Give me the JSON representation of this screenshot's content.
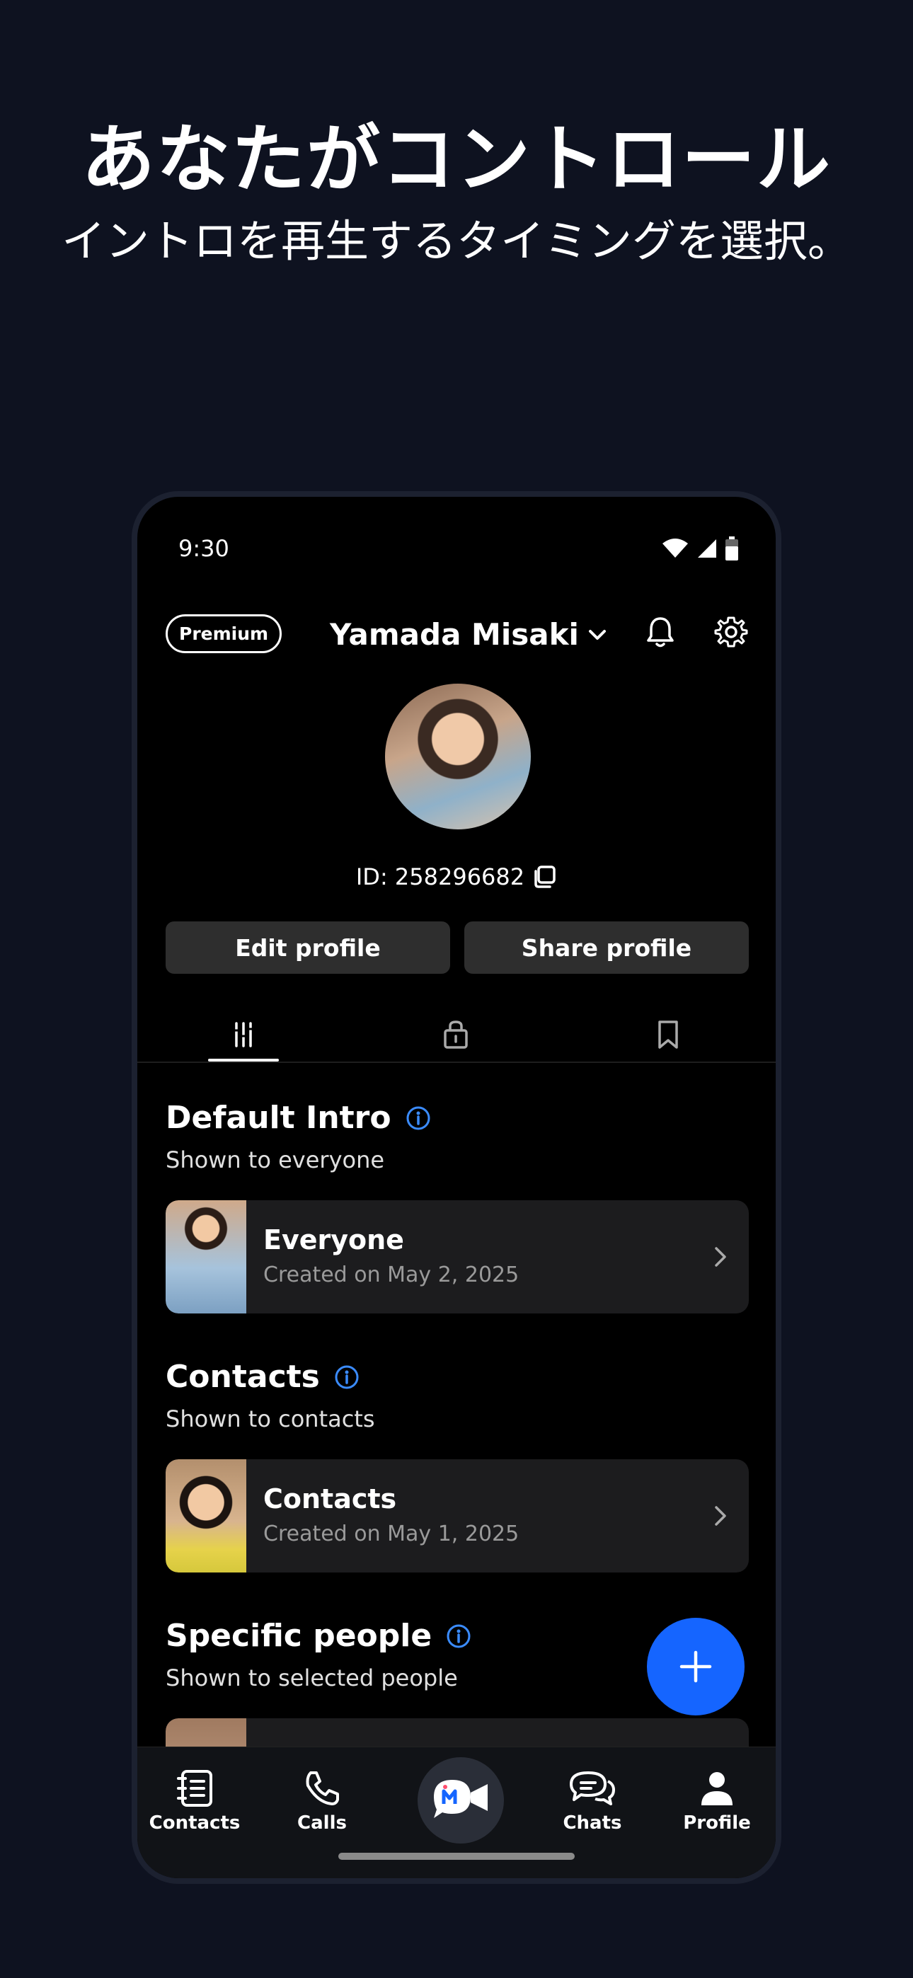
{
  "promo": {
    "headline": "あなたがコントロール",
    "subline": "イントロを再生するタイミングを選択。"
  },
  "status_bar": {
    "time": "9:30"
  },
  "header": {
    "badge": "Premium",
    "user_name": "Yamada Misaki"
  },
  "profile": {
    "id_text": "ID: 258296682",
    "edit_label": "Edit profile",
    "share_label": "Share profile"
  },
  "sections": [
    {
      "title": "Default Intro",
      "subtitle": "Shown to everyone",
      "card": {
        "title": "Everyone",
        "subtitle": "Created on May 2, 2025"
      }
    },
    {
      "title": "Contacts",
      "subtitle": "Shown to contacts",
      "card": {
        "title": "Contacts",
        "subtitle": "Created on May 1, 2025"
      }
    },
    {
      "title": "Specific people",
      "subtitle": "Shown to selected people"
    }
  ],
  "bottom_nav": [
    {
      "label": "Contacts",
      "icon": "contacts-icon"
    },
    {
      "label": "Calls",
      "icon": "phone-icon"
    },
    {
      "label": "",
      "icon": "app-logo-video-icon"
    },
    {
      "label": "Chats",
      "icon": "chat-bubbles-icon"
    },
    {
      "label": "Profile",
      "icon": "person-icon"
    }
  ],
  "colors": {
    "background": "#0e1220",
    "accent": "#1565ff",
    "info": "#3b8cff"
  }
}
